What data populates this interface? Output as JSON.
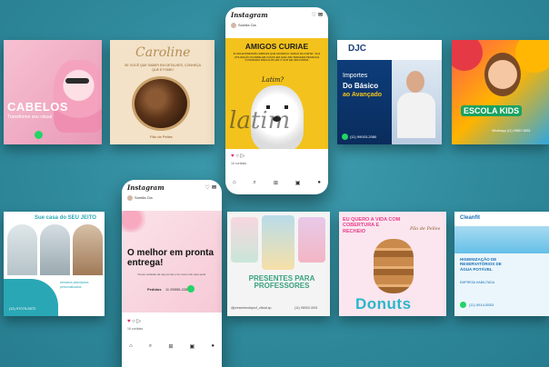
{
  "posts": {
    "cabelos": {
      "headline": "CABELOS",
      "sub": "Transforme seu visual"
    },
    "caroline": {
      "brand": "Caroline",
      "tagline": "SE VOCÊ QUE SABER EM DETALHES, CONHEÇA QUE É FOME!",
      "footer": "Pão de Pelles"
    },
    "amigos": {
      "title": "AMIGOS CURIAE",
      "body": "É UMA EXPRESSÃO SIMPLES QUE SIGNIFICA \"AMIGO DA CORTE\". SUA UTILIZAÇÃO OCORRE EM CASOS EM QUE UMA TERCEIRA PESSOA É CONVIDADA PARA AUXILIAR O JUIZ DE UMA FORMA",
      "latin": "Latim?",
      "script": "latim"
    },
    "ingles": {
      "logo": "DJC",
      "line1": "Importes",
      "line2": "Do Básico",
      "line3": "ao Avançado",
      "phone": "(11) 99003-2080"
    },
    "kids": {
      "title": "ESCOLA KIDS",
      "phone": "Whatsapp (11) 99887-6553"
    },
    "sue": {
      "title": "Sue casa do SEU JEITO",
      "sub": "armários planejados personalizados",
      "phone": "(11) 97075-5572"
    },
    "professores": {
      "title": "PRESENTES PARA PROFESSORES",
      "handle": "@presentesdaprof_oficial.sp",
      "phone": "(11) 98000-3001"
    },
    "donuts": {
      "top": "EU QUERO A VIDA COM COBERTURA E RECHEIO",
      "brand": "Pão de Pelles",
      "title": "Donuts"
    },
    "clean": {
      "logo": "Cleanfit",
      "title": "HIGIENIZAÇÃO DE RESERVATÓRIOS DE ÁGUA POTÁVEL",
      "sub": "EMPRESA HABILITADA",
      "phone": "(11) 5914-5553"
    }
  },
  "phone_top": {
    "app": "Instagram",
    "user": "Sorella Cia",
    "likes": "16 curtidas",
    "icons": "♡ ✉"
  },
  "phone_bottom": {
    "app": "Instagram",
    "user": "Sorella Cia",
    "headline": "O melhor em pronta entrega!",
    "sub": "Peças variadas da loja pronta e do nosso site para pedir",
    "phone_label": "Pedidos",
    "phone": "11 95555-2283",
    "likes": "16 curtidas"
  }
}
